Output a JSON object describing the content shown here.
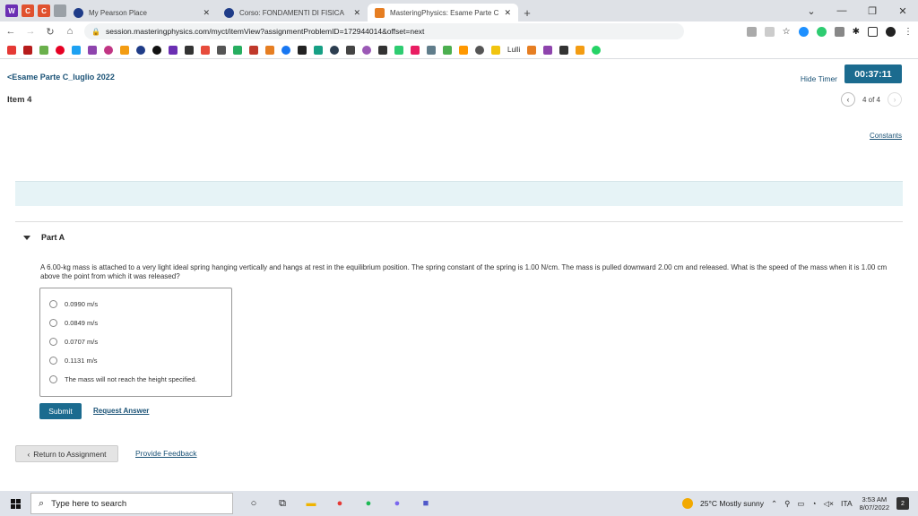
{
  "browser": {
    "tabs": [
      {
        "title": "My Pearson Place",
        "favicon_color": "#1f3c88"
      },
      {
        "title": "Corso: FONDAMENTI DI FISICA",
        "favicon_color": "#1f3c88"
      },
      {
        "title": "MasteringPhysics: Esame Parte C",
        "favicon_color": "#e67e22"
      }
    ],
    "url": "session.masteringphysics.com/myct/itemView?assignmentProblemID=172944014&offset=next",
    "bookmark_text": "Lulli",
    "new_tab_symbol": "+"
  },
  "header": {
    "breadcrumb": "Esame Parte C_luglio 2022",
    "item_label": "Item 4",
    "hide_timer": "Hide Timer",
    "timer": "00:37:11",
    "pager": "4 of 4",
    "constants": "Constants"
  },
  "part": {
    "title": "Part A",
    "question": "A 6.00-kg mass is attached to a very light ideal spring hanging vertically and hangs at rest in the equilibrium position. The spring constant of the spring is 1.00 N/cm. The mass is pulled downward 2.00 cm and released. What is the speed of the mass when it is 1.00 cm above the point from which it was released?",
    "choices": [
      {
        "label": "0.0990 m/s"
      },
      {
        "label": "0.0849 m/s"
      },
      {
        "label": "0.0707 m/s"
      },
      {
        "label": "0.1131 m/s"
      },
      {
        "label": "The mass will not reach the height specified."
      }
    ],
    "submit": "Submit",
    "request_answer": "Request Answer"
  },
  "footer": {
    "return": "Return to Assignment",
    "feedback": "Provide Feedback"
  },
  "taskbar": {
    "search_placeholder": "Type here to search",
    "weather": "25°C  Mostly sunny",
    "lang": "ITA",
    "time": "3:53 AM",
    "date": "8/07/2022",
    "notifications": "2"
  },
  "colors": {
    "primary": "#1b6b8f",
    "band": "#e6f3f6"
  }
}
